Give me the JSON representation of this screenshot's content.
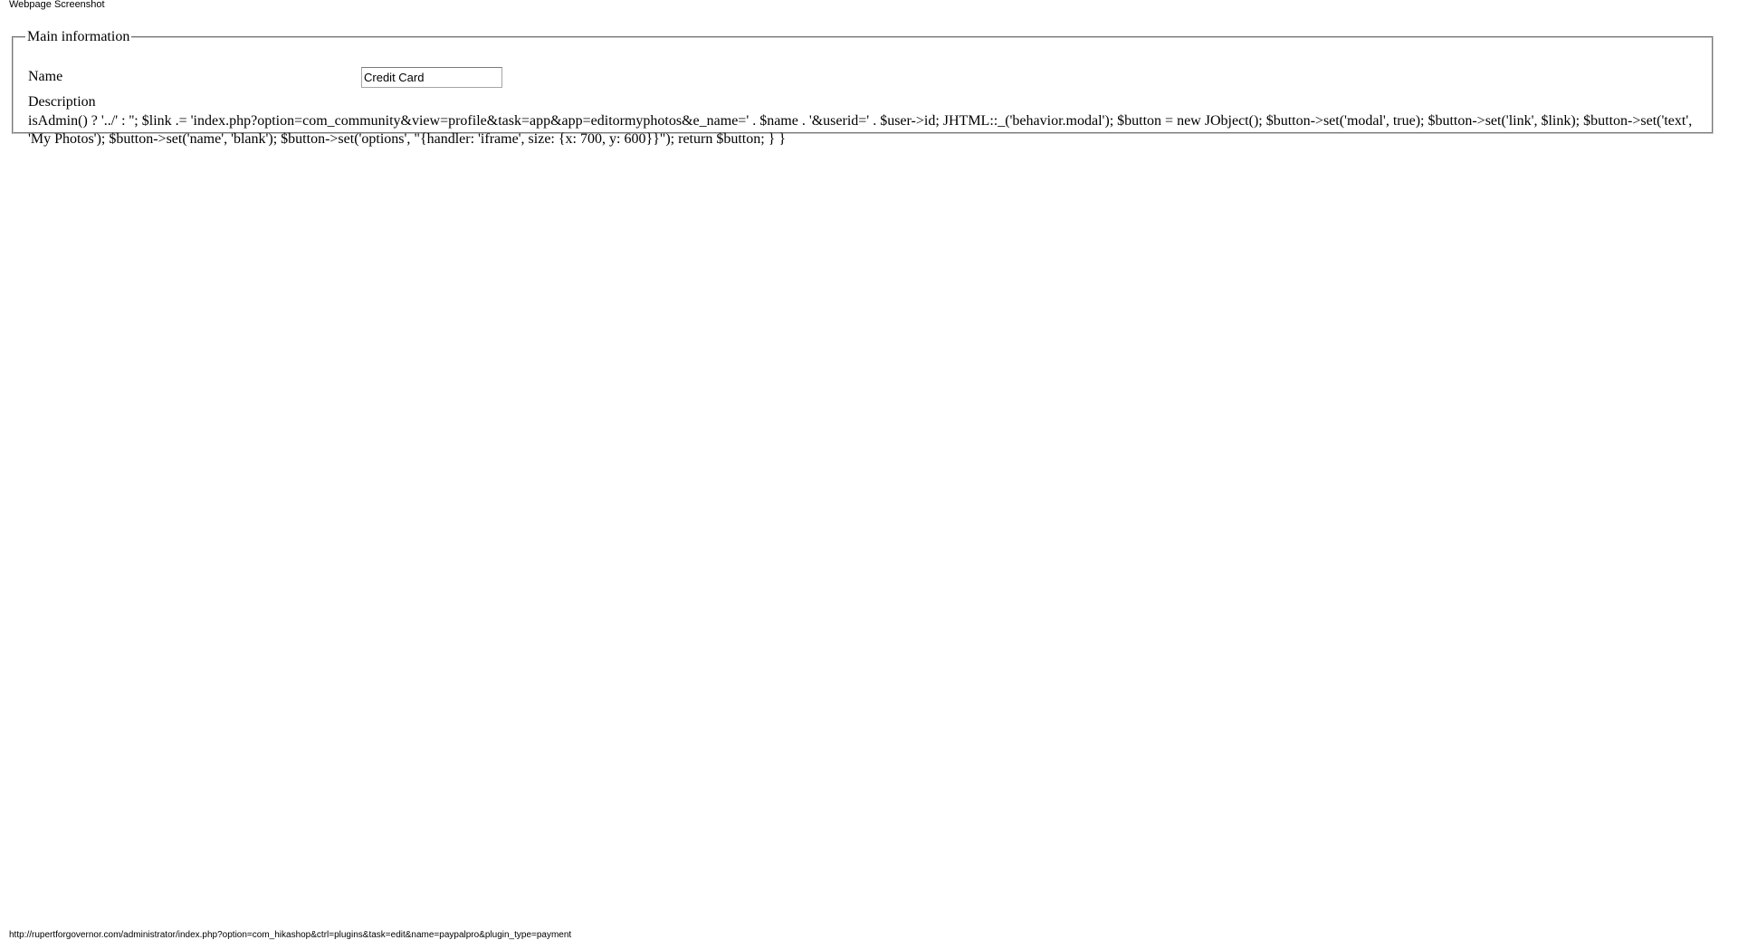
{
  "page": {
    "header": "Webpage Screenshot",
    "status_url": "http://rupertforgovernor.com/administrator/index.php?option=com_hikashop&ctrl=plugins&task=edit&name=paypalpro&plugin_type=payment"
  },
  "main_info": {
    "legend": "Main information",
    "name_label": "Name",
    "name_value": "Credit Card",
    "description_label": "Description",
    "description_text": "isAdmin() ? '../' : ''; $link .= 'index.php?option=com_community&view=profile&task=app&app=editormyphotos&e_name=' . $name . '&userid=' . $user->id; JHTML::_('behavior.modal'); $button = new JObject(); $button->set('modal', true); $button->set('link', $link); $button->set('text', 'My Photos'); $button->set('name', 'blank'); $button->set('options', \"{handler: 'iframe', size: {x: 700, y: 600}}\"); return $button; } }"
  }
}
